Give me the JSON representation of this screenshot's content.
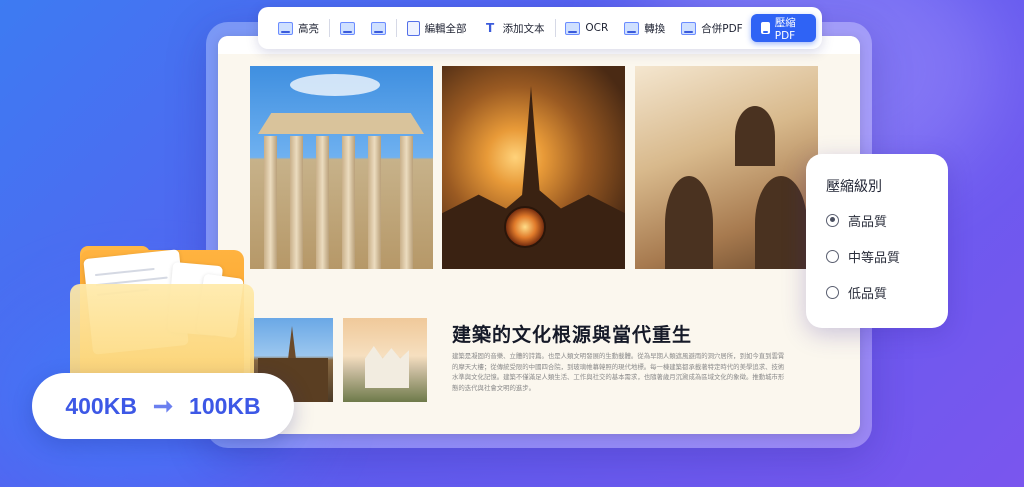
{
  "toolbar": {
    "items": [
      {
        "label": "高亮",
        "icon": "highlight-icon"
      },
      {
        "label": "",
        "icon": "underline-icon"
      },
      {
        "label": "",
        "icon": "eraser-icon"
      },
      {
        "label": "編輯全部",
        "icon": "edit-icon"
      },
      {
        "label": "添加文本",
        "icon": "text-icon"
      },
      {
        "label": "OCR",
        "icon": "ocr-icon"
      },
      {
        "label": "轉換",
        "icon": "convert-icon"
      },
      {
        "label": "合併PDF",
        "icon": "merge-icon"
      }
    ],
    "compress_label": "壓縮PDF"
  },
  "article": {
    "title": "建築的文化根源與當代重生",
    "body": "建築是凝固的音樂、立體的詩篇。也是人類文明發展的生動載體。從為早期人類遮風避雨的洞穴居所，到如今直到雲霄的摩天大樓；從傳統受限的中國四合院，到玻璃帷幕韓照的現代地標。每一棟建築都承載著特定時代的美學追求、技術水準與文化記憶。建築不僅滿足人類生活、工作與社交的基本需求，也隨著歲月沉澱成為區域文化的象徵。推動城市形態的迭代與社會文明的進步。"
  },
  "compression_panel": {
    "title": "壓縮級別",
    "options": [
      {
        "label": "高品質",
        "selected": true
      },
      {
        "label": "中等品質",
        "selected": false
      },
      {
        "label": "低品質",
        "selected": false
      }
    ]
  },
  "file_size": {
    "before": "400KB",
    "after": "100KB"
  },
  "colors": {
    "accent": "#2f63f5",
    "folder": "#f59a1e",
    "size_text": "#3d58e6"
  }
}
